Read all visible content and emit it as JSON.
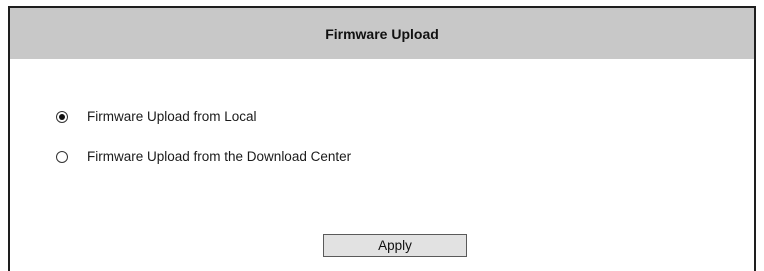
{
  "panel": {
    "title": "Firmware Upload"
  },
  "options": [
    {
      "label": "Firmware Upload from Local",
      "selected": true
    },
    {
      "label": "Firmware Upload from the Download Center",
      "selected": false
    }
  ],
  "apply_label": "Apply",
  "colors": {
    "header_bg": "#c8c8c8",
    "border": "#1e1e1e",
    "button_bg": "#e2e2e2"
  }
}
